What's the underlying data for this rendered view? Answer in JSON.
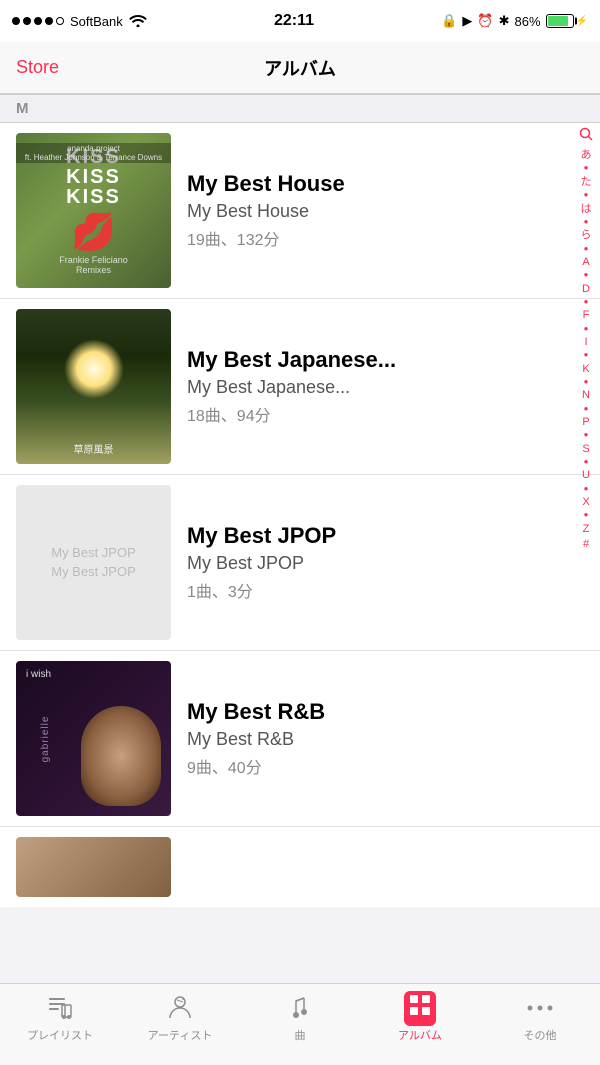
{
  "status": {
    "carrier": "SoftBank",
    "time": "22:11",
    "battery_percent": "86%"
  },
  "nav": {
    "store_label": "Store",
    "title": "アルバム"
  },
  "section": {
    "letter": "M"
  },
  "albums": [
    {
      "id": "kiss",
      "title": "My Best House",
      "subtitle": "My Best House",
      "meta": "19曲、132分",
      "art_type": "kiss"
    },
    {
      "id": "japanese",
      "title": "My Best Japanese...",
      "subtitle": "My Best Japanese...",
      "meta": "18曲、94分",
      "art_type": "japanese"
    },
    {
      "id": "jpop",
      "title": "My Best JPOP",
      "subtitle": "My Best JPOP",
      "meta": "1曲、3分",
      "art_type": "jpop"
    },
    {
      "id": "rnb",
      "title": "My Best R&B",
      "subtitle": "My Best R&B",
      "meta": "9曲、40分",
      "art_type": "rnb"
    }
  ],
  "index_bar": {
    "items": [
      "あ",
      "●",
      "た",
      "●",
      "は",
      "●",
      "ら",
      "●",
      "A",
      "●",
      "D",
      "●",
      "F",
      "●",
      "I",
      "●",
      "K",
      "●",
      "N",
      "●",
      "P",
      "●",
      "S",
      "●",
      "U",
      "●",
      "X",
      "●",
      "Z",
      "#"
    ]
  },
  "tabs": [
    {
      "id": "playlist",
      "label": "プレイリスト",
      "active": false
    },
    {
      "id": "artist",
      "label": "アーティスト",
      "active": false
    },
    {
      "id": "song",
      "label": "曲",
      "active": false
    },
    {
      "id": "album",
      "label": "アルバム",
      "active": true
    },
    {
      "id": "more",
      "label": "その他",
      "active": false
    }
  ]
}
